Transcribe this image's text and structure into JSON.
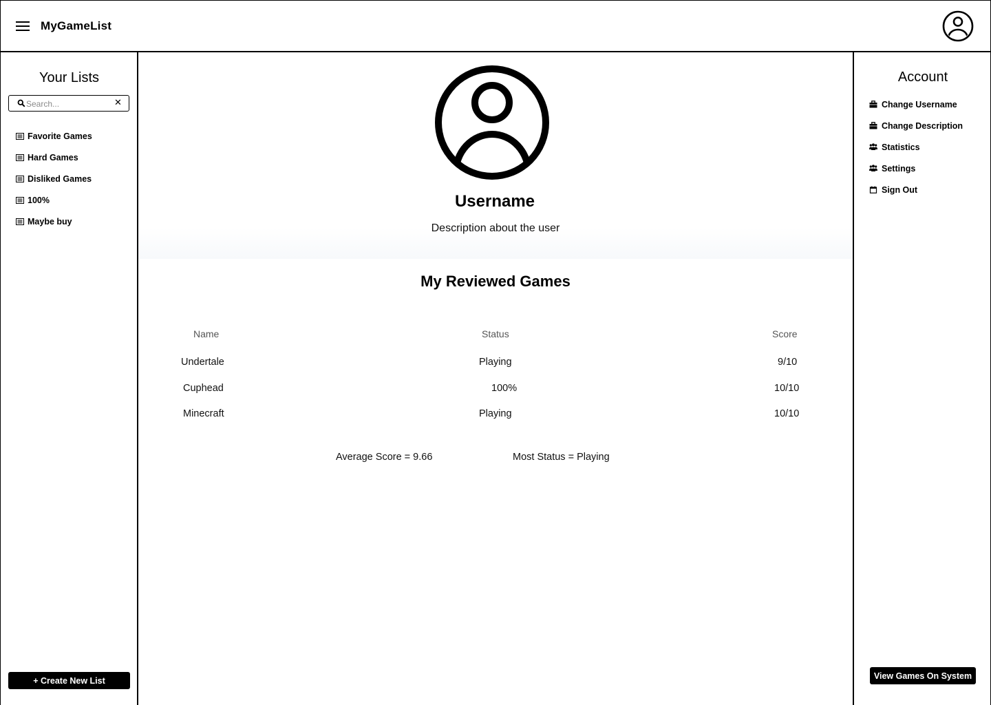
{
  "header": {
    "app_title": "MyGameList",
    "menu_icon": "hamburger-menu-icon",
    "avatar_icon": "user-avatar-icon"
  },
  "left_sidebar": {
    "title": "Your Lists",
    "search": {
      "placeholder": "Search...",
      "value": ""
    },
    "lists": [
      {
        "label": "Favorite Games",
        "icon": "list-icon"
      },
      {
        "label": "Hard Games",
        "icon": "list-icon"
      },
      {
        "label": "Disliked Games",
        "icon": "list-icon"
      },
      {
        "label": "100%",
        "icon": "list-icon"
      },
      {
        "label": "Maybe buy",
        "icon": "list-icon"
      }
    ],
    "create_button": "+ Create New List"
  },
  "profile": {
    "username": "Username",
    "description": "Description about the user"
  },
  "reviews": {
    "title": "My Reviewed Games",
    "columns": [
      "Name",
      "Status",
      "Score"
    ],
    "rows": [
      {
        "name": "Undertale",
        "status": "Playing",
        "score": "9/10"
      },
      {
        "name": "Cuphead",
        "status": "100%",
        "score": "10/10"
      },
      {
        "name": "Minecraft",
        "status": "Playing",
        "score": "10/10"
      }
    ],
    "average_score": "Average Score = 9.66",
    "most_status": "Most Status = Playing"
  },
  "right_sidebar": {
    "title": "Account",
    "items": [
      {
        "label": "Change Username",
        "icon": "briefcase-icon"
      },
      {
        "label": "Change Description",
        "icon": "briefcase-icon"
      },
      {
        "label": "Statistics",
        "icon": "users-icon"
      },
      {
        "label": "Settings",
        "icon": "users-icon"
      },
      {
        "label": "Sign Out",
        "icon": "calendar-icon"
      }
    ],
    "view_games_button": "View Games On System"
  },
  "colors": {
    "primary": "#000000",
    "background": "#ffffff",
    "muted_text": "#555555"
  }
}
